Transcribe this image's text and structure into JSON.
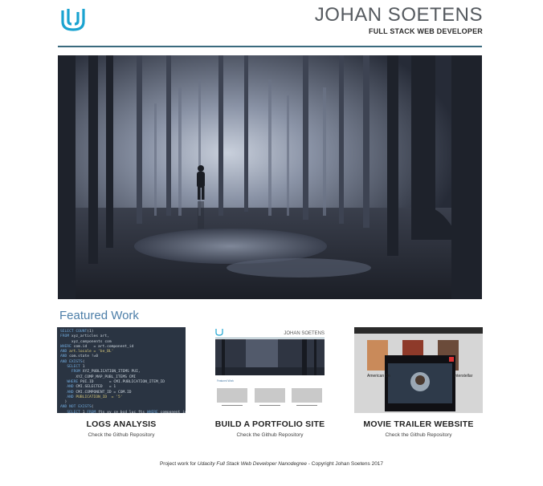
{
  "header": {
    "name": "JOHAN SOETENS",
    "subtitle": "FULL STACK WEB DEVELOPER"
  },
  "section": {
    "title": "Featured Work"
  },
  "projects": [
    {
      "title": "LOGS ANALYSIS",
      "link": "Check the Github Repository",
      "code_lines": [
        "SELECT COUNT(1)",
        "FROM xyz_articles art,",
        "     xyz_components com",
        "WHERE com.id   = art.component_id",
        "AND art.locale = 'be_BL'",
        "AND com.state !=0",
        "AND EXISTS(",
        "   SELECT 1",
        "     FROM XYZ_PUBLICATION_ITEMS PUI,",
        "       XYZ_COMP_MAP_PUBL_ITEMS CMI",
        "   WHERE PUI.ID       = CMI.PUBLICATION_ITEM_ID",
        "   AND CMI.SELECTED   = 1",
        "   AND CMI.COMPONENT_ID = COM.ID",
        "   AND PUBLICATION_ID  = '5'",
        "  )",
        "AND NOT EXISTS(",
        "   SELECT 1 FROM fts_xy_ce_bcd_luc fts WHERE component_id = com.id",
        ");"
      ]
    },
    {
      "title": "BUILD A PORTFOLIO SITE",
      "link": "Check the Github Repository",
      "mini_name": "JOHAN SOETENS",
      "mini_section": "Featured Work"
    },
    {
      "title": "MOVIE TRAILER WEBSITE",
      "link": "Check the Github Repository",
      "mini_labels": [
        "American Sn",
        "Interstellar"
      ]
    }
  ],
  "footer": {
    "prefix": "Project work for ",
    "course": "Udacity Full Stack Web Developer Nanodegree",
    "suffix": " - Copyright Johan Soetens 2017"
  },
  "colors": {
    "accent": "#1aa3d0",
    "rule": "#3a6a7e",
    "section_title": "#4c7ea8"
  }
}
